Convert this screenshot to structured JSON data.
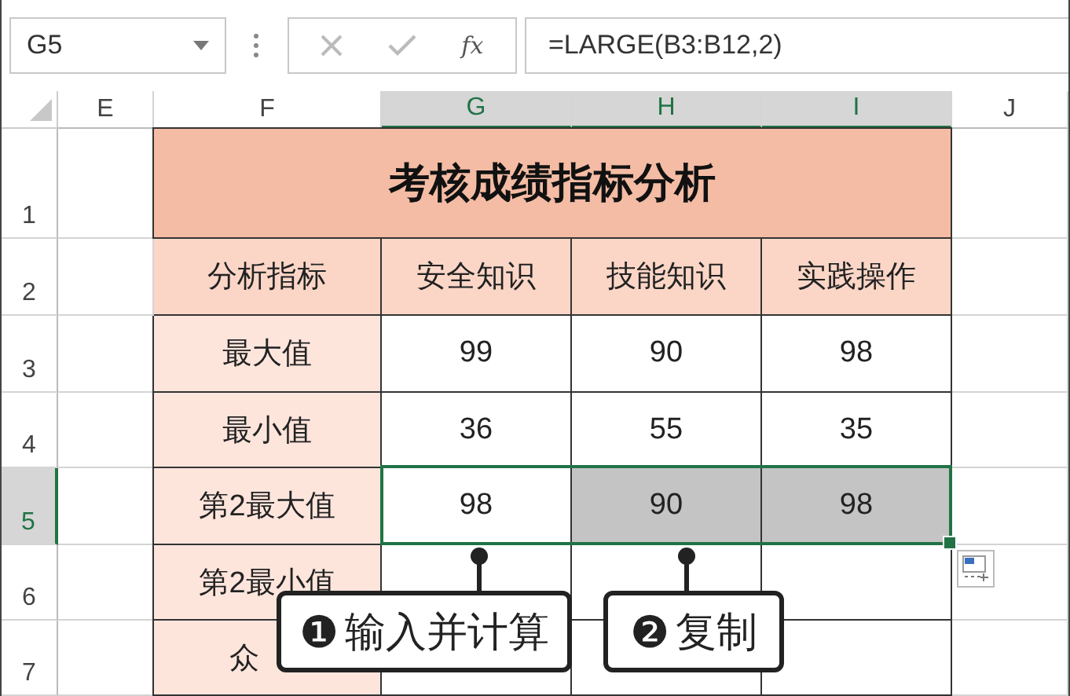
{
  "name_box": {
    "value": "G5"
  },
  "formula_bar": {
    "function_label": "fx",
    "formula": "=LARGE(B3:B12,2)"
  },
  "columns": [
    {
      "label": "E",
      "selected": false
    },
    {
      "label": "F",
      "selected": false
    },
    {
      "label": "G",
      "selected": true
    },
    {
      "label": "H",
      "selected": true
    },
    {
      "label": "I",
      "selected": true
    },
    {
      "label": "J",
      "selected": false
    }
  ],
  "row_headers": [
    {
      "label": "1",
      "selected": false
    },
    {
      "label": "2",
      "selected": false
    },
    {
      "label": "3",
      "selected": false
    },
    {
      "label": "4",
      "selected": false
    },
    {
      "label": "5",
      "selected": true
    },
    {
      "label": "6",
      "selected": false
    },
    {
      "label": "7",
      "selected": false
    }
  ],
  "title": "考核成绩指标分析",
  "header": {
    "label": "分析指标",
    "cells": [
      "安全知识",
      "技能知识",
      "实践操作"
    ]
  },
  "rows": [
    {
      "label": "最大值",
      "selected": false,
      "cells": [
        {
          "text": "99",
          "filled": false
        },
        {
          "text": "90",
          "filled": false
        },
        {
          "text": "98",
          "filled": false
        }
      ]
    },
    {
      "label": "最小值",
      "selected": false,
      "cells": [
        {
          "text": "36",
          "filled": false
        },
        {
          "text": "55",
          "filled": false
        },
        {
          "text": "35",
          "filled": false
        }
      ]
    },
    {
      "label": "第2最大值",
      "selected": true,
      "cells": [
        {
          "text": "98",
          "filled": false
        },
        {
          "text": "90",
          "filled": true
        },
        {
          "text": "98",
          "filled": true
        }
      ]
    },
    {
      "label": "第2最小值",
      "selected": false,
      "cells": []
    },
    {
      "label": "众",
      "selected": false,
      "cells": []
    }
  ],
  "callouts": [
    {
      "number": "❶",
      "text": "输入并计算"
    },
    {
      "number": "❷",
      "text": "复制"
    }
  ]
}
